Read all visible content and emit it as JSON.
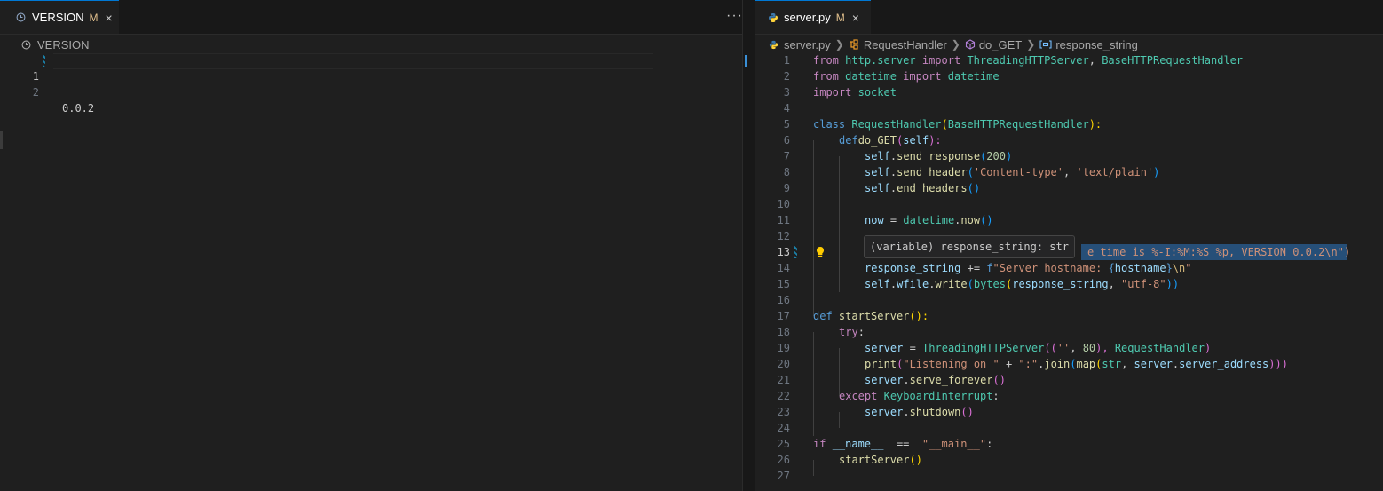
{
  "colors": {
    "accent": "#0078d4",
    "modified": "#e2c08d",
    "editor_bg": "#1f1f1f"
  },
  "left_editor": {
    "tab": {
      "label": "VERSION",
      "modified": "M",
      "close": "×",
      "icon": "history-icon"
    },
    "more_actions": "···",
    "breadcrumb": {
      "file": "VERSION",
      "icon": "history-icon"
    },
    "lines": [
      {
        "num": "1",
        "text": "0.0.2"
      },
      {
        "num": "2",
        "text": ""
      }
    ]
  },
  "right_editor": {
    "tab": {
      "label": "server.py",
      "modified": "M",
      "close": "×",
      "icon": "python-icon"
    },
    "breadcrumb": [
      {
        "label": "server.py",
        "icon": "python-icon"
      },
      {
        "label": "RequestHandler",
        "icon": "class-icon"
      },
      {
        "label": "do_GET",
        "icon": "method-icon"
      },
      {
        "label": "response_string",
        "icon": "variable-icon"
      }
    ],
    "hover_tooltip": "(variable) response_string: str",
    "line_numbers": [
      "1",
      "2",
      "3",
      "4",
      "5",
      "6",
      "7",
      "8",
      "9",
      "10",
      "11",
      "12",
      "13",
      "14",
      "15",
      "16",
      "17",
      "18",
      "19",
      "20",
      "21",
      "22",
      "23",
      "24",
      "25",
      "26",
      "27"
    ],
    "code": {
      "l1": [
        "from",
        "http.server",
        "import",
        "ThreadingHTTPServer",
        ", ",
        "BaseHTTPRequestHandler"
      ],
      "l2": [
        "from",
        "datetime",
        "import",
        "datetime"
      ],
      "l3": [
        "import",
        "socket"
      ],
      "l5": [
        "class",
        "RequestHandler",
        "(",
        "BaseHTTPRequestHandler",
        "):"
      ],
      "l6": [
        "def",
        "do_GET",
        "(",
        "self",
        "):"
      ],
      "l7": [
        "self",
        ".",
        "send_response",
        "(",
        "200",
        ")"
      ],
      "l8": [
        "self",
        ".",
        "send_header",
        "(",
        "'Content-type'",
        ", ",
        "'text/plain'",
        ")"
      ],
      "l9": [
        "self",
        ".",
        "end_headers",
        "()"
      ],
      "l11": [
        "now",
        " = ",
        "datetime",
        ".",
        "now",
        "()"
      ],
      "l13_visible": "e time is %-I:%M:%S %p, VERSION 0.0.2\\n\")",
      "l14": [
        "response_string",
        " += ",
        "f",
        "\"Server hostname: ",
        "{",
        "hostname",
        "}",
        "\\n",
        "\""
      ],
      "l15": [
        "self",
        ".",
        "wfile",
        ".",
        "write",
        "(",
        "bytes",
        "(",
        "response_string",
        ", ",
        "\"utf-8\"",
        "))"
      ],
      "l17": [
        "def",
        "startServer",
        "():"
      ],
      "l18": [
        "try",
        ":"
      ],
      "l19": [
        "server",
        " = ",
        "ThreadingHTTPServer",
        "((",
        "''",
        ", ",
        "80",
        "), ",
        "RequestHandler",
        ")"
      ],
      "l20": [
        "print",
        "(",
        "\"Listening on \"",
        " + ",
        "\":\"",
        ".",
        "join",
        "(",
        "map",
        "(",
        "str",
        ", ",
        "server",
        ".",
        "server_address",
        ")))"
      ],
      "l21": [
        "server",
        ".",
        "serve_forever",
        "()"
      ],
      "l22": [
        "except",
        "KeyboardInterrupt",
        ":"
      ],
      "l23": [
        "server",
        ".",
        "shutdown",
        "()"
      ],
      "l25": [
        "if",
        "__name__",
        " == ",
        "\"__main__\"",
        ":"
      ],
      "l26": [
        "startServer",
        "()"
      ]
    }
  }
}
